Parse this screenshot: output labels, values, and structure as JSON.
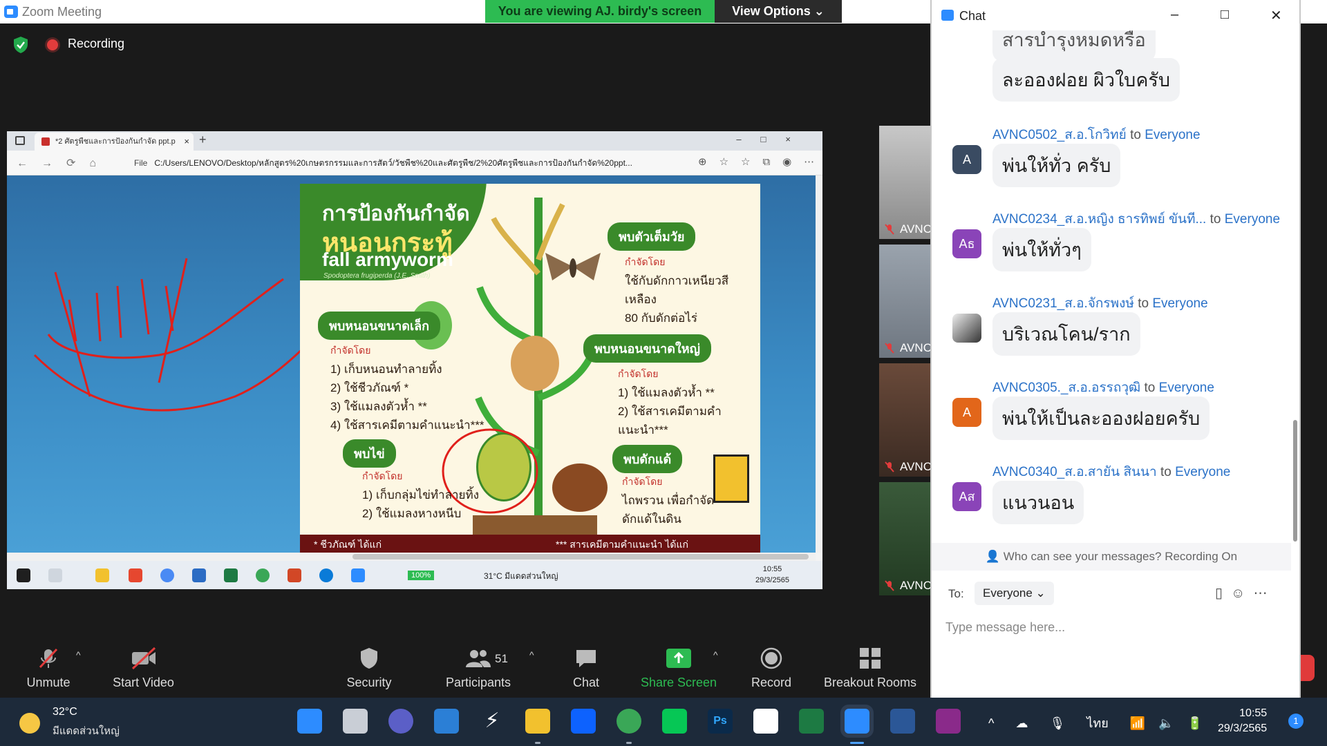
{
  "window": {
    "title": "Zoom Meeting"
  },
  "banner": {
    "viewing": "You are viewing AJ. birdy's screen",
    "view_options": "View Options ⌄"
  },
  "recording": {
    "label": "Recording"
  },
  "browser": {
    "tab_title": "*2 ศัตรูพืชและการป้องกันกำจัด ppt.p",
    "url_prefix": "File",
    "url": "C:/Users/LENOVO/Desktop/หลักสูตร%20เกษตรกรรมและการสัตว์/วัชพืช%20และศัตรูพืช/2%20ศัตรูพืชและการป้องกันกำจัด%20ppt..."
  },
  "slide": {
    "title_line1": "การป้องกันกำจัด",
    "title_line2": "หนอนกระทู้",
    "title_line3": "fall armyworm",
    "scientific": "Spodoptera frugiperda (J.E. Smith)",
    "adult": {
      "label": "พบตัวเต็มวัย",
      "method_head": "กำจัดโดย",
      "lines": [
        "ใช้กับดักกาวเหนียวสีเหลือง",
        "80 กับดักต่อไร่"
      ]
    },
    "small_larva": {
      "label": "พบหนอนขนาดเล็ก",
      "method_head": "กำจัดโดย",
      "lines": [
        "1) เก็บหนอนทำลายทิ้ง",
        "2) ใช้ชีวภัณฑ์ *",
        "3) ใช้แมลงตัวห้ำ **",
        "4) ใช้สารเคมีตามคำแนะนำ***"
      ]
    },
    "large_larva": {
      "label": "พบหนอนขนาดใหญ่",
      "method_head": "กำจัดโดย",
      "lines": [
        "1) ใช้แมลงตัวห้ำ **",
        "2) ใช้สารเคมีตามคำแนะนำ***"
      ]
    },
    "egg": {
      "label": "พบไข่",
      "method_head": "กำจัดโดย",
      "lines": [
        "1) เก็บกลุ่มไข่ทำลายทิ้ง",
        "2) ใช้แมลงหางหนีบ"
      ]
    },
    "pupa": {
      "label": "พบดักแด้",
      "method_head": "กำจัดโดย",
      "lines": [
        "ไถพรวน เพื่อกำจัด",
        "ดักแด้ในดิน"
      ]
    },
    "footer_left": "* ชีวภัณฑ์ ได้แก่",
    "footer_right": "*** สารเคมีตามคำแนะนำ ได้แก่"
  },
  "inner_taskbar": {
    "zoom": "100%",
    "weather": "31°C มีแดดส่วนใหญ่",
    "time": "10:55",
    "date": "29/3/2565"
  },
  "thumbnails": [
    "AVNC",
    "AVNC",
    "AVNC",
    "AVNC"
  ],
  "controls": {
    "unmute": "Unmute",
    "start_video": "Start Video",
    "security": "Security",
    "participants": "Participants",
    "participants_count": "51",
    "chat": "Chat",
    "share_screen": "Share Screen",
    "record": "Record",
    "breakout_rooms": "Breakout Rooms"
  },
  "chat": {
    "title": "Chat",
    "top_partial": "สารบำรุงหมดหรือ",
    "messages": [
      {
        "sender": "",
        "to": "",
        "recipient": "",
        "text": "ละอองฝอย ผิวใบครับ",
        "avatar": ""
      },
      {
        "sender": "AVNC0502_ส.อ.โกวิทย์",
        "to": "to",
        "recipient": "Everyone",
        "text": "พ่นให้ทั่ว ครับ",
        "avatar": "A"
      },
      {
        "sender": "AVNC0234_ส.อ.หญิง ธารทิพย์ ขันที...",
        "to": "to",
        "recipient": "Everyone",
        "text": "พ่นให้ทั่วๆ",
        "avatar": "Aธ"
      },
      {
        "sender": "AVNC0231_ส.อ.จักรพงษ์",
        "to": "to",
        "recipient": "Everyone",
        "text": "บริเวณโคน/ราก",
        "avatar": ""
      },
      {
        "sender": "AVNC0305._ส.อ.อรรถวุฒิ",
        "to": "to",
        "recipient": "Everyone",
        "text": "พ่นให้เป็นละอองฝอยครับ",
        "avatar": "A"
      },
      {
        "sender": "AVNC0340_ส.อ.สายัน สินนา",
        "to": "to",
        "recipient": "Everyone",
        "text": "แนวนอน",
        "avatar": "Aส"
      }
    ],
    "privacy": "Who can see your messages? Recording On",
    "to_label": "To:",
    "to_value": "Everyone ⌄",
    "placeholder": "Type message here..."
  },
  "taskbar": {
    "temp": "32°C",
    "weather": "มีแดดส่วนใหญ่",
    "time": "10:55",
    "date": "29/3/2565",
    "lang": "ไทย",
    "notifications": "1"
  },
  "colors": {
    "zoom_blue": "#2d8cff",
    "banner_green": "#2dbb52",
    "link_blue": "#2b72c8"
  }
}
